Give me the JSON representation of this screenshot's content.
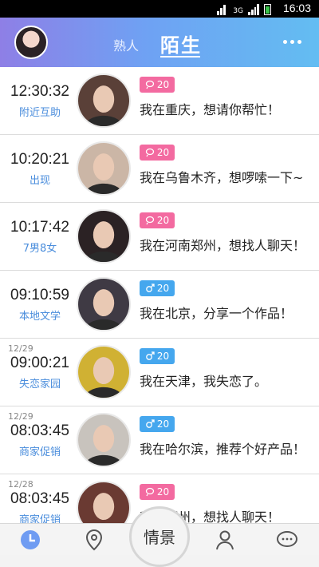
{
  "status": {
    "network": "3G",
    "time": "16:03"
  },
  "header": {
    "tab_acquaintance": "熟人",
    "tab_strangers": "陌生"
  },
  "colors": {
    "female": "#f36aa0",
    "male": "#45a7ee",
    "tag": "#4a8ddc"
  },
  "rows": [
    {
      "date": "",
      "time": "12:30:32",
      "tag": "附近互助",
      "gender": "female",
      "age": "20",
      "message": "我在重庆，想请你帮忙！"
    },
    {
      "date": "",
      "time": "10:20:21",
      "tag": "出现",
      "gender": "female",
      "age": "20",
      "message": "我在乌鲁木齐，想啰嗦一下~"
    },
    {
      "date": "",
      "time": "10:17:42",
      "tag": "7男8女",
      "gender": "female",
      "age": "20",
      "message": "我在河南郑州，想找人聊天！"
    },
    {
      "date": "",
      "time": "09:10:59",
      "tag": "本地文学",
      "gender": "male",
      "age": "20",
      "message": "我在北京，分享一个作品！"
    },
    {
      "date": "12/29",
      "time": "09:00:21",
      "tag": "失恋家园",
      "gender": "male",
      "age": "20",
      "message": "我在天津，我失恋了。"
    },
    {
      "date": "12/29",
      "time": "08:03:45",
      "tag": "商家促销",
      "gender": "male",
      "age": "20",
      "message": "我在哈尔滨，推荐个好产品！"
    },
    {
      "date": "12/28",
      "time": "08:03:45",
      "tag": "商家促销",
      "gender": "female",
      "age": "20",
      "message": "我在郑州，想找人聊天！"
    }
  ],
  "bottom": {
    "center_label": "情景"
  }
}
